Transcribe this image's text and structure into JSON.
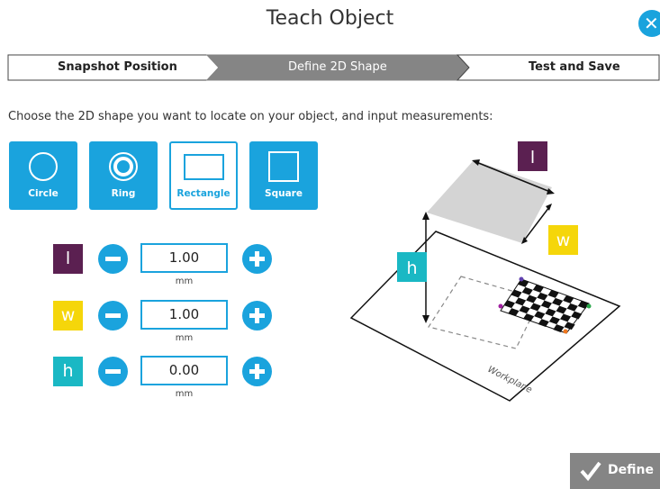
{
  "header": {
    "title": "Teach Object",
    "close_icon": "close-icon"
  },
  "steps": [
    {
      "label": "Snapshot Position",
      "state": "done"
    },
    {
      "label": "Define 2D Shape",
      "state": "active"
    },
    {
      "label": "Test and Save",
      "state": "pending"
    }
  ],
  "instruction": "Choose the 2D shape you want to locate on your object, and input measurements:",
  "shapes": [
    {
      "label": "Circle",
      "icon": "circle-icon",
      "selected": false
    },
    {
      "label": "Ring",
      "icon": "ring-icon",
      "selected": false
    },
    {
      "label": "Rectangle",
      "icon": "rectangle-icon",
      "selected": true
    },
    {
      "label": "Square",
      "icon": "square-icon",
      "selected": false
    }
  ],
  "measurements": [
    {
      "symbol": "l",
      "value": "1.00",
      "unit": "mm",
      "color": "#5b2051"
    },
    {
      "symbol": "w",
      "value": "1.00",
      "unit": "mm",
      "color": "#f5d60a"
    },
    {
      "symbol": "h",
      "value": "0.00",
      "unit": "mm",
      "color": "#1ab8c4"
    }
  ],
  "diagram": {
    "labels": {
      "l": "l",
      "w": "w",
      "h": "h"
    },
    "workplane_label": "Workplane"
  },
  "footer": {
    "define_label": "Define",
    "define_icon": "checkmark-icon"
  },
  "colors": {
    "accent": "#1aa3dd",
    "step_active": "#858585",
    "button_disabled": "#858585"
  }
}
